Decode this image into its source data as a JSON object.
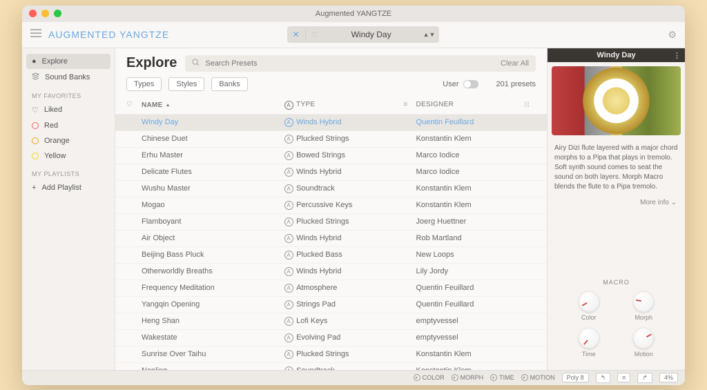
{
  "titlebar": {
    "title": "Augmented YANGTZE"
  },
  "brand": "AUGMENTED YANGTZE",
  "preset_bar": {
    "name": "Windy Day"
  },
  "sidebar": {
    "explore": "Explore",
    "sound_banks": "Sound Banks",
    "favorites_header": "MY FAVORITES",
    "liked": "Liked",
    "red": "Red",
    "orange": "Orange",
    "yellow": "Yellow",
    "playlists_header": "MY PLAYLISTS",
    "add_playlist": "Add Playlist"
  },
  "explore": {
    "title": "Explore",
    "search_placeholder": "Search Presets",
    "clear_all": "Clear All",
    "types": "Types",
    "styles": "Styles",
    "banks": "Banks",
    "user": "User",
    "count": "201 presets"
  },
  "columns": {
    "name": "NAME",
    "type": "TYPE",
    "designer": "DESIGNER"
  },
  "presets": [
    {
      "name": "Windy Day",
      "type": "Winds Hybrid",
      "designer": "Quentin Feuillard",
      "selected": true
    },
    {
      "name": "Chinese Duet",
      "type": "Plucked Strings",
      "designer": "Konstantin Klem"
    },
    {
      "name": "Erhu Master",
      "type": "Bowed Strings",
      "designer": "Marco Iodice"
    },
    {
      "name": "Delicate Flutes",
      "type": "Winds Hybrid",
      "designer": "Marco Iodice"
    },
    {
      "name": "Wushu Master",
      "type": "Soundtrack",
      "designer": "Konstantin Klem"
    },
    {
      "name": "Mogao",
      "type": "Percussive Keys",
      "designer": "Konstantin Klem"
    },
    {
      "name": "Flamboyant",
      "type": "Plucked Strings",
      "designer": "Joerg Huettner"
    },
    {
      "name": "Air Object",
      "type": "Winds Hybrid",
      "designer": "Rob Martland"
    },
    {
      "name": "Beijing Bass Pluck",
      "type": "Plucked Bass",
      "designer": "New Loops"
    },
    {
      "name": "Otherworldly Breaths",
      "type": "Winds Hybrid",
      "designer": "Lily Jordy"
    },
    {
      "name": "Frequency Meditation",
      "type": "Atmosphere",
      "designer": "Quentin Feuillard"
    },
    {
      "name": "Yangqin Opening",
      "type": "Strings Pad",
      "designer": "Quentin Feuillard"
    },
    {
      "name": "Heng Shan",
      "type": "Lofi Keys",
      "designer": "emptyvessel"
    },
    {
      "name": "Wakestate",
      "type": "Evolving Pad",
      "designer": "emptyvessel"
    },
    {
      "name": "Sunrise Over Taihu",
      "type": "Plucked Strings",
      "designer": "Konstantin Klem"
    },
    {
      "name": "Nanling",
      "type": "Soundtrack",
      "designer": "Konstantin Klem"
    }
  ],
  "preview": {
    "title": "Windy Day",
    "desc": "Airy Dizi flute layered with a major chord morphs to a Pipa that plays in tremolo. Soft synth sound comes to seat the sound on both layers. Morph Macro blends the flute to a Pipa tremolo.",
    "more_info": "More info"
  },
  "macro": {
    "title": "MACRO",
    "knobs": [
      "Color",
      "Morph",
      "Time",
      "Motion"
    ]
  },
  "bottombar": {
    "color": "COLOR",
    "morph": "MORPH",
    "time": "TIME",
    "motion": "MOTION",
    "poly": "Poly 8",
    "pct": "4%"
  }
}
